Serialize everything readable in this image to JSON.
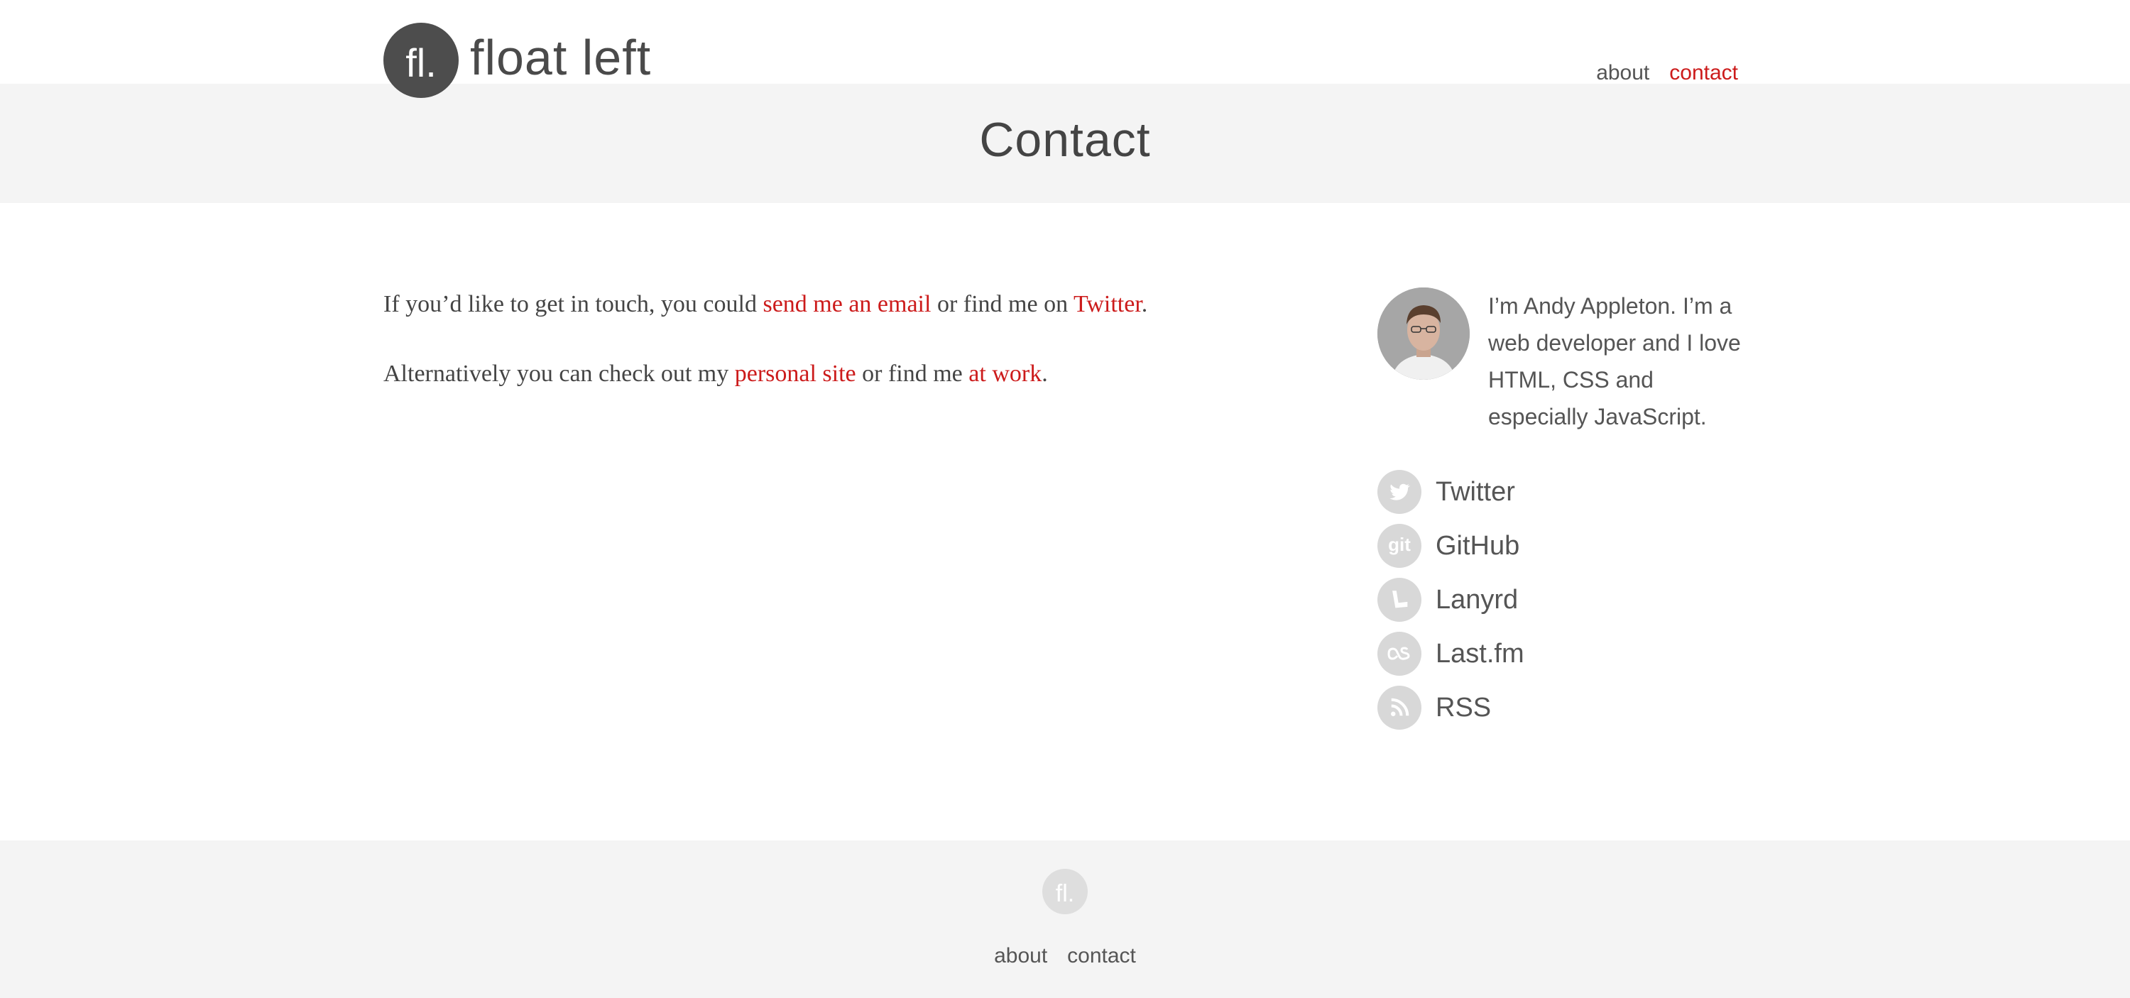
{
  "header": {
    "logo_mark": "fl.",
    "site_name": "float left",
    "nav": [
      "about",
      "contact"
    ]
  },
  "page": {
    "title": "Contact"
  },
  "content": {
    "p1": {
      "before": "If you’d like to get in touch, you could ",
      "link1": "send me an email",
      "middle": " or find me on ",
      "link2": "Twitter",
      "after": "."
    },
    "p2": {
      "before": "Alternatively you can check out my ",
      "link1": "personal site",
      "middle": " or find me ",
      "link2": "at work",
      "after": "."
    }
  },
  "sidebar": {
    "bio": "I’m Andy Appleton. I’m a web developer and I love HTML, CSS and especially JavaScript.",
    "links": [
      {
        "label": "Twitter",
        "icon": "twitter-icon"
      },
      {
        "label": "GitHub",
        "icon": "github-icon"
      },
      {
        "label": "Lanyrd",
        "icon": "lanyrd-icon"
      },
      {
        "label": "Last.fm",
        "icon": "lastfm-icon"
      },
      {
        "label": "RSS",
        "icon": "rss-icon"
      }
    ]
  },
  "footer": {
    "logo_mark": "fl.",
    "nav": [
      "about",
      "contact"
    ]
  },
  "colors": {
    "accent": "#cc1b1b",
    "text": "#4a4a4a",
    "band": "#f4f4f4",
    "icon_bg": "#d8d8d8"
  }
}
